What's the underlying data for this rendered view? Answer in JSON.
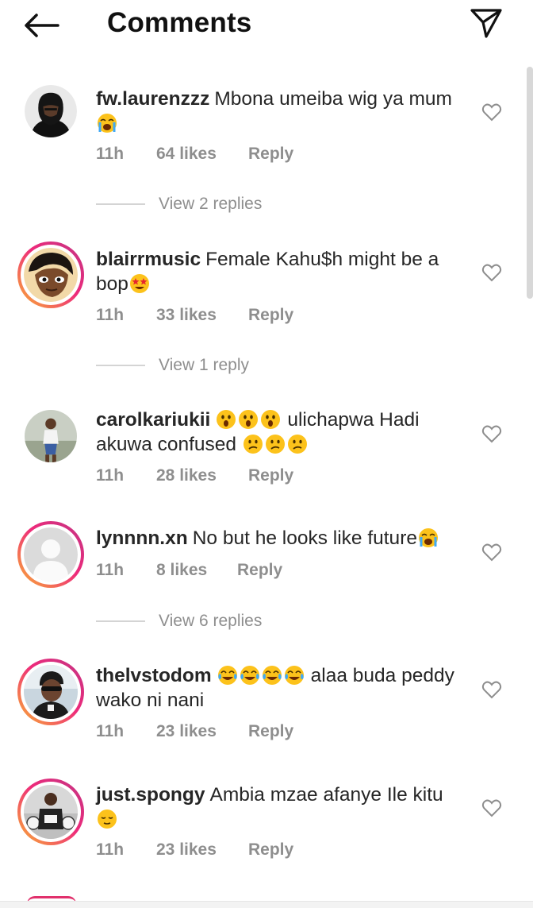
{
  "header": {
    "title": "Comments",
    "back_icon": "arrow-left-icon",
    "share_icon": "paper-plane-icon"
  },
  "colors": {
    "story_ring_start": "#f9b233",
    "story_ring_end": "#c13584",
    "meta_text": "#8e8e8e",
    "primary_text": "#262626"
  },
  "comments": [
    {
      "username": "fw.laurenzzz",
      "text_parts": [
        "Mbona umeiba wig ya mum"
      ],
      "emojis": [
        "loudly-crying-face"
      ],
      "time": "11h",
      "likes": "64 likes",
      "reply": "Reply",
      "view_replies": "View 2 replies",
      "story_ring": false
    },
    {
      "username": "blairrmusic",
      "text_parts": [
        "Female Kahu$h might be a bop"
      ],
      "emojis": [
        "star-struck-face"
      ],
      "time": "11h",
      "likes": "33 likes",
      "reply": "Reply",
      "view_replies": "View 1 reply",
      "story_ring": true
    },
    {
      "username": "carolkariukii",
      "text_parts": [
        "ulichapwa Hadi akuwa confused"
      ],
      "emojis": [
        "astonished-face",
        "astonished-face",
        "astonished-face",
        "confused-face",
        "confused-face",
        "confused-face"
      ],
      "time": "11h",
      "likes": "28 likes",
      "reply": "Reply",
      "view_replies": "",
      "story_ring": false
    },
    {
      "username": "lynnnn.xn",
      "text_parts": [
        "No but he looks like future"
      ],
      "emojis": [
        "loudly-crying-face"
      ],
      "time": "11h",
      "likes": "8 likes",
      "reply": "Reply",
      "view_replies": "View 6 replies",
      "story_ring": true
    },
    {
      "username": "thelvstodom",
      "text_parts": [
        "alaa buda peddy wako ni nani"
      ],
      "emojis": [
        "tears-of-joy-face",
        "tears-of-joy-face",
        "tears-of-joy-face",
        "tears-of-joy-face"
      ],
      "time": "11h",
      "likes": "23 likes",
      "reply": "Reply",
      "view_replies": "",
      "story_ring": true
    },
    {
      "username": "just.spongy",
      "text_parts": [
        "Ambia mzae afanye Ile kitu"
      ],
      "emojis": [
        "relieved-face"
      ],
      "time": "11h",
      "likes": "23 likes",
      "reply": "Reply",
      "view_replies": "",
      "story_ring": true
    }
  ]
}
